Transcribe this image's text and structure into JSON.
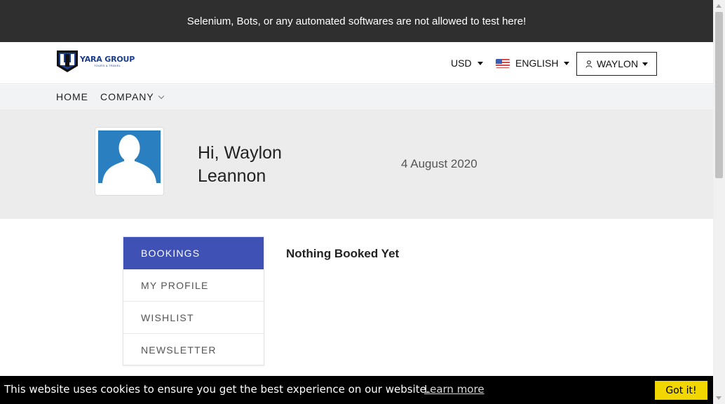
{
  "warning": {
    "text": "Selenium, Bots, or any automated softwares are not allowed to test here!"
  },
  "header": {
    "logo_name": "YARA GROUP",
    "logo_tagline": "TOURS & TRAVEL",
    "currency": "USD",
    "language": "ENGLISH",
    "user": "WAYLON"
  },
  "nav": {
    "home": "HOME",
    "company": "COMPANY"
  },
  "profile": {
    "greeting_line1": "Hi, Waylon",
    "greeting_line2": "Leannon",
    "date": "4 August 2020"
  },
  "menu": {
    "items": [
      {
        "label": "BOOKINGS",
        "active": true
      },
      {
        "label": "MY PROFILE"
      },
      {
        "label": "WISHLIST"
      },
      {
        "label": "NEWSLETTER"
      }
    ]
  },
  "content": {
    "empty_message": "Nothing Booked Yet"
  },
  "cookie": {
    "message": "This website uses cookies to ensure you get the best experience on our website.",
    "learn_more": "Learn more",
    "accept": "Got it!"
  },
  "colors": {
    "accent": "#3f51b5",
    "cookie_button": "#f1d600",
    "warning_bg": "#2f2f2f"
  },
  "icons": [
    "logo-mark",
    "flag-us-icon",
    "user-icon",
    "caret-down-icon",
    "chevron-down-icon",
    "avatar-placeholder"
  ]
}
